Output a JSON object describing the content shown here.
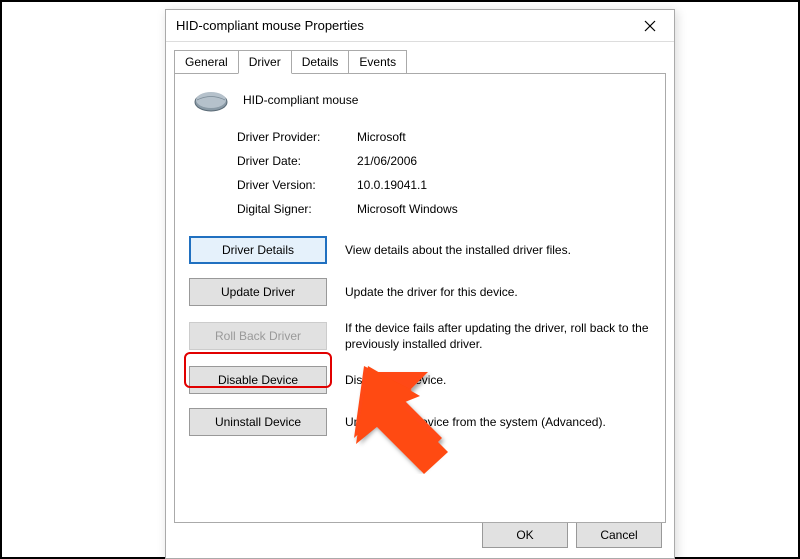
{
  "window": {
    "title": "HID-compliant mouse Properties"
  },
  "tabs": {
    "general": "General",
    "driver": "Driver",
    "details": "Details",
    "events": "Events"
  },
  "device": {
    "name": "HID-compliant mouse"
  },
  "info": {
    "provider_label": "Driver Provider:",
    "provider_value": "Microsoft",
    "date_label": "Driver Date:",
    "date_value": "21/06/2006",
    "version_label": "Driver Version:",
    "version_value": "10.0.19041.1",
    "signer_label": "Digital Signer:",
    "signer_value": "Microsoft Windows"
  },
  "buttons": {
    "details": {
      "label": "Driver Details",
      "desc": "View details about the installed driver files."
    },
    "update": {
      "label": "Update Driver",
      "desc": "Update the driver for this device."
    },
    "rollback": {
      "label": "Roll Back Driver",
      "desc": "If the device fails after updating the driver, roll back to the previously installed driver."
    },
    "disable": {
      "label": "Disable Device",
      "desc": "Disable the device."
    },
    "uninstall": {
      "label": "Uninstall Device",
      "desc": "Uninstall the device from the system (Advanced)."
    }
  },
  "dialog_buttons": {
    "ok": "OK",
    "cancel": "Cancel"
  }
}
